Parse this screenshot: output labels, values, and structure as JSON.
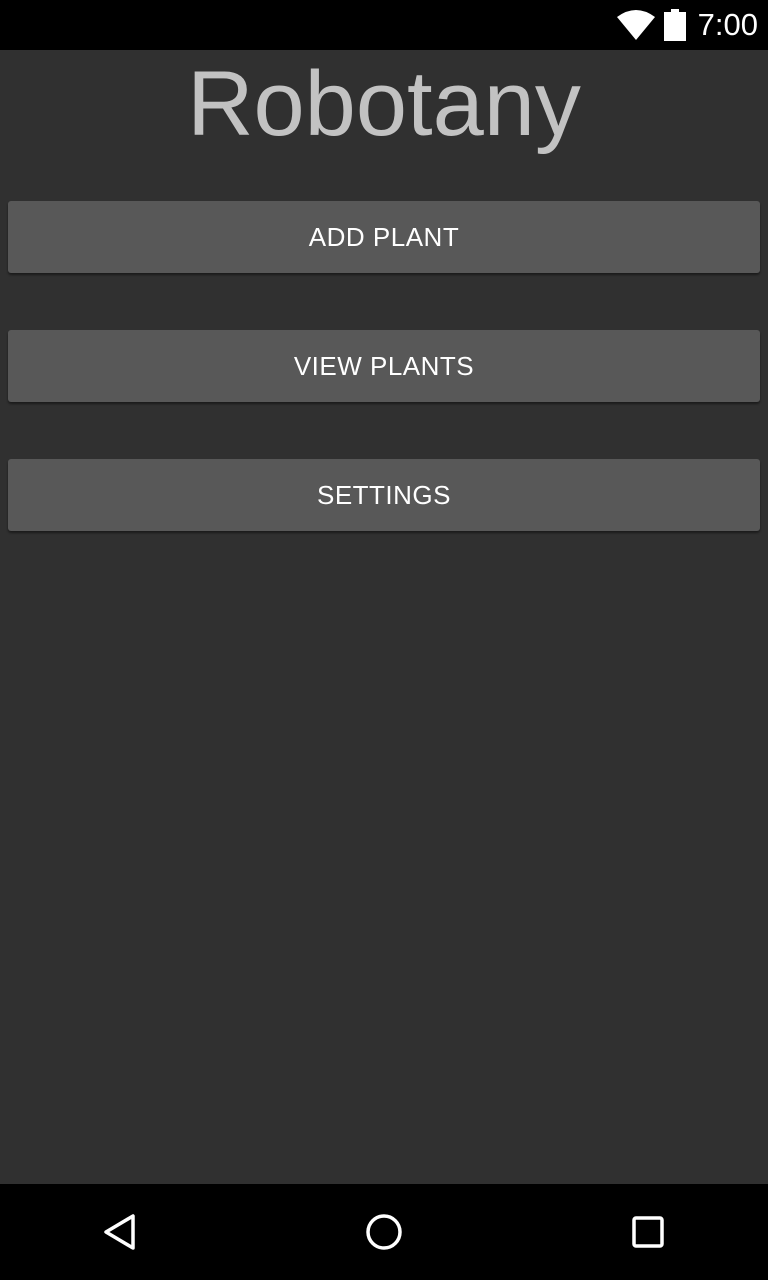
{
  "status_bar": {
    "time": "7:00",
    "wifi_icon": "wifi-full-icon",
    "battery_icon": "battery-full-icon"
  },
  "app": {
    "title": "Robotany"
  },
  "menu": {
    "add_plant_label": "ADD PLANT",
    "view_plants_label": "VIEW PLANTS",
    "settings_label": "SETTINGS"
  },
  "nav_bar": {
    "back_icon": "back-triangle-icon",
    "home_icon": "home-circle-icon",
    "recent_icon": "recent-apps-square-icon"
  },
  "colors": {
    "background": "#303030",
    "button": "#585858",
    "title_text": "#c2c2c2",
    "bars": "#000000"
  }
}
